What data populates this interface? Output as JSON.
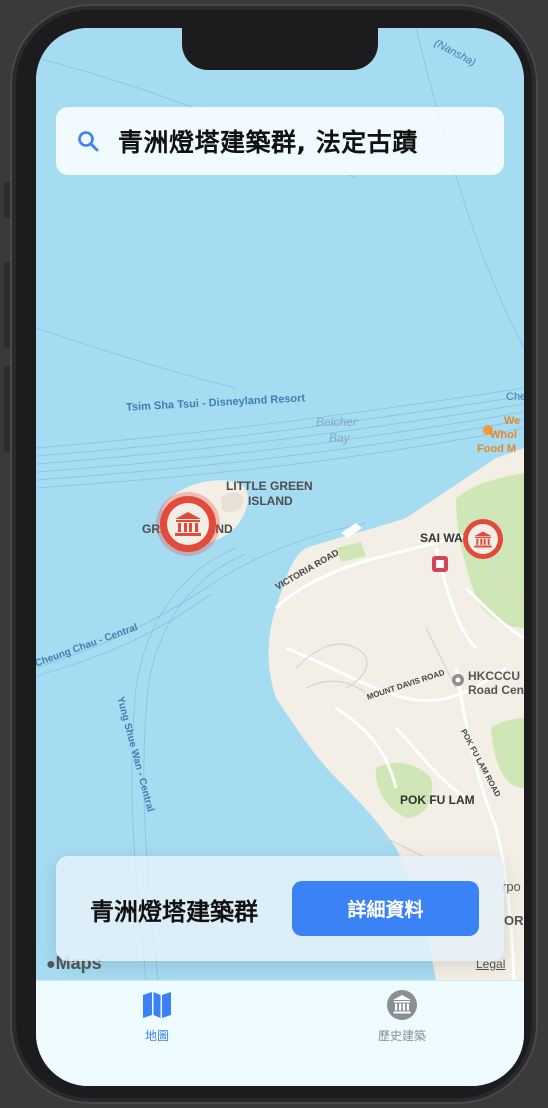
{
  "search": {
    "icon": "search-icon",
    "query": "青洲燈塔建築群, 法定古蹟"
  },
  "map": {
    "labels": {
      "nansha": "(Nansha)",
      "tsim_sha_tsui_route": "Tsim Sha Tsui - Disneyland Resort",
      "belcher_bay_line1": "Belcher",
      "belcher_bay_line2": "Bay",
      "little_green_island_line1": "LITTLE GREEN",
      "little_green_island_line2": "ISLAND",
      "green_island": "GREEN ISLAND",
      "sai_wan": "SAI WAN",
      "victoria_road": "VICTORIA ROAD",
      "cheung_chau_route": "Cheung Chau - Central",
      "yung_shue_wan_route": "Yung Shue Wan - Central",
      "mount_davis_road": "MOUNT DAVIS ROAD",
      "pok_fu_lam": "POK FU LAM",
      "pok_fu_lam_road": "POK FU LAM ROAD",
      "hkcccu_line1": "HKCCCU",
      "hkcccu_line2": "Road Cen",
      "whole_foods_line1": "We",
      "whole_foods_line2": "Whol",
      "whole_foods_line3": "Food M",
      "che_partial": "Che",
      "rpo_partial": "rpo",
      "or_partial": "OR"
    },
    "brand": "Maps",
    "legal": "Legal",
    "colors": {
      "water": "#a6dcf2",
      "land": "#f4efe6",
      "park": "#cfe7b6",
      "marker": "#e24a3b",
      "route": "#6fa6cf"
    }
  },
  "card": {
    "title": "青洲燈塔建築群",
    "button_label": "詳細資料"
  },
  "tabbar": {
    "tabs": [
      {
        "label": "地圖",
        "icon": "map-icon",
        "selected": true
      },
      {
        "label": "歷史建築",
        "icon": "museum-icon",
        "selected": false
      }
    ],
    "colors": {
      "selected": "#3b82f6",
      "unselected": "#8a8f96"
    }
  }
}
